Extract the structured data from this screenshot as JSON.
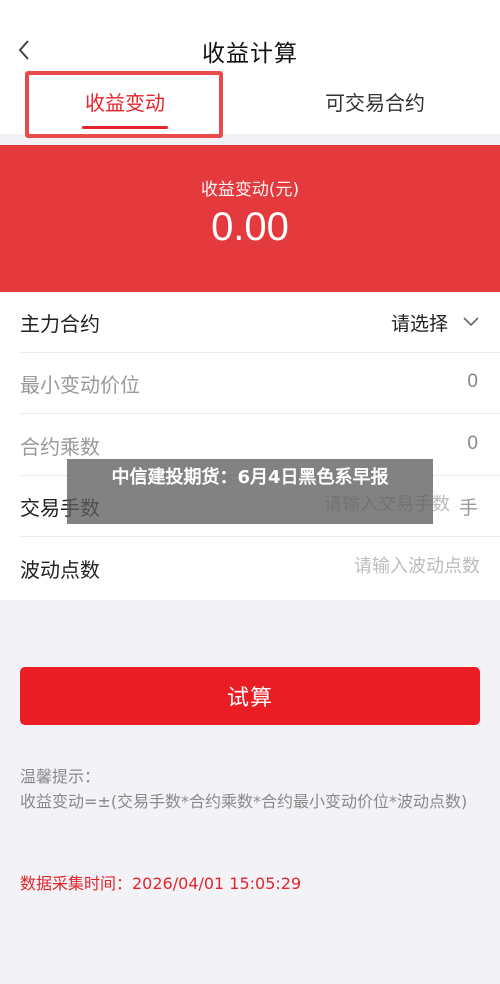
{
  "nav": {
    "title": "收益计算",
    "back_icon": "chevron-left-icon"
  },
  "tabs": [
    {
      "label": "收益变动",
      "active": true
    },
    {
      "label": "可交易合约",
      "active": false
    }
  ],
  "hero": {
    "label": "收益变动(元)",
    "value": "0.00"
  },
  "form": {
    "main_contract": {
      "label": "主力合约",
      "value": "请选择"
    },
    "min_tick": {
      "label": "最小变动价位",
      "value": "0"
    },
    "multiplier": {
      "label": "合约乘数",
      "value": "0"
    },
    "lots": {
      "label": "交易手数",
      "placeholder": "请输入交易手数",
      "unit": "手"
    },
    "ticks": {
      "label": "波动点数",
      "placeholder": "请输入波动点数"
    }
  },
  "calc_button": "试算",
  "tips": {
    "title": "温馨提示：",
    "body": "收益变动=±(交易手数*合约乘数*合约最小变动价位*波动点数)"
  },
  "data_time": "数据采集时间：2026/04/01 15:05:29",
  "overlay_caption": "中信建投期货：6月4日黑色系早报",
  "colors": {
    "accent": "#e3242b",
    "hero_bg": "#e53a3d",
    "button_bg": "#ea1c24",
    "page_bg": "#f3f3f7"
  }
}
